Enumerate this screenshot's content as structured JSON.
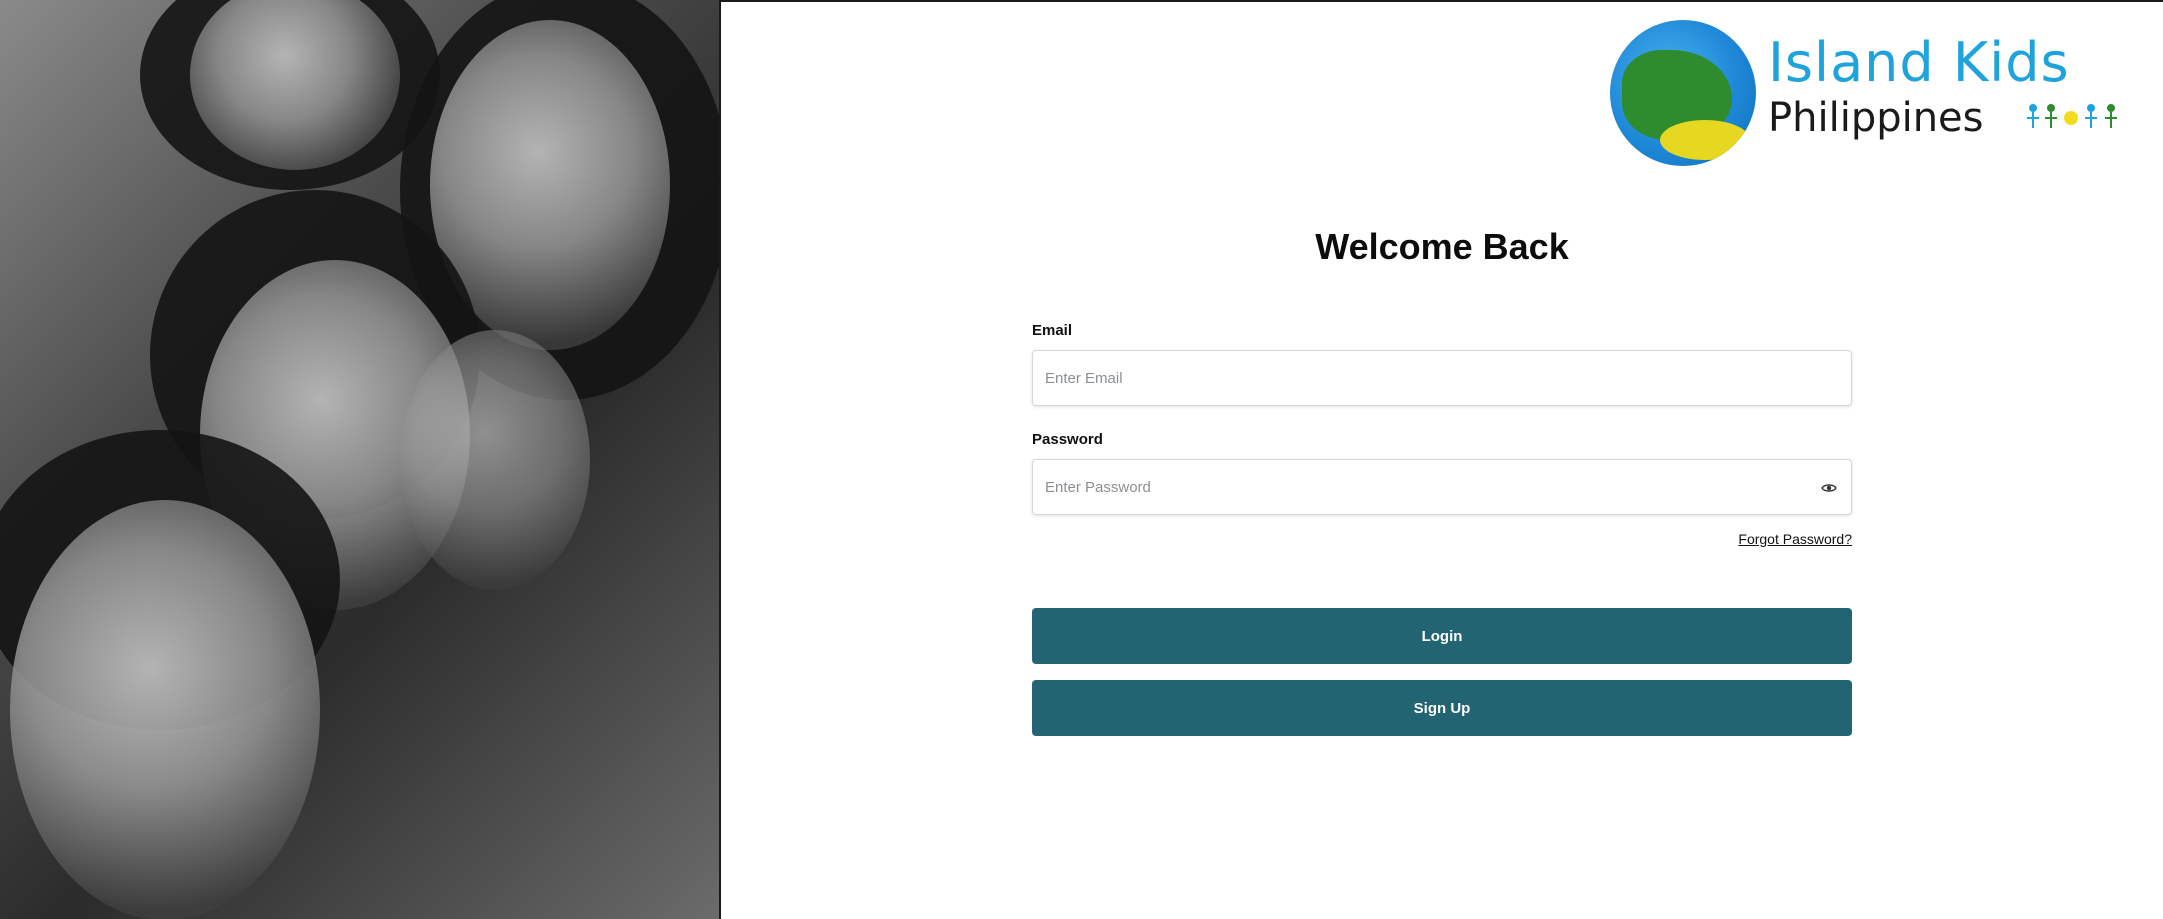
{
  "logo": {
    "title": "Island Kids",
    "subtitle": "Philippines",
    "icon": "globe-island-logo-icon",
    "title_color": "#1fa3dd"
  },
  "hero_image": {
    "icon": "children-photo-image"
  },
  "login": {
    "heading": "Welcome Back",
    "email_label": "Email",
    "email_placeholder": "Enter Email",
    "email_value": "",
    "password_label": "Password",
    "password_placeholder": "Enter Password",
    "password_value": "",
    "password_toggle_icon": "eye-icon",
    "forgot_password": "Forgot Password?",
    "login_button": "Login",
    "signup_button": "Sign Up",
    "button_color": "#236473"
  }
}
